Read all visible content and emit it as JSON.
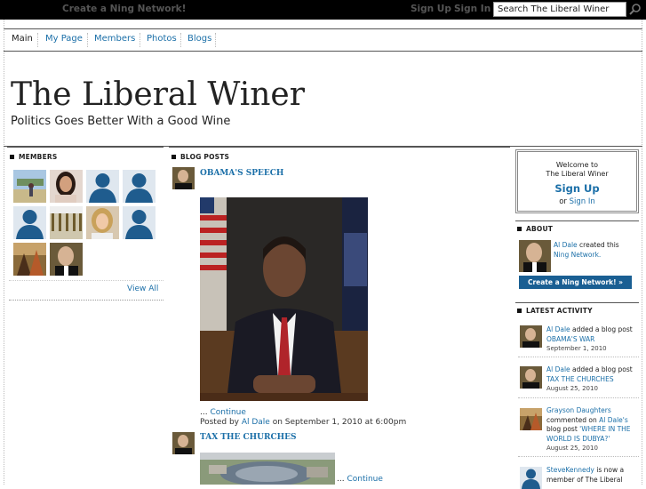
{
  "topbar": {
    "create_label": "Create a Ning Network!",
    "signup_label": "Sign Up",
    "signin_label": "Sign In",
    "search_value": "Search The Liberal Winer"
  },
  "nav": {
    "items": [
      "Main",
      "My Page",
      "Members",
      "Photos",
      "Blogs"
    ]
  },
  "header": {
    "title": "The Liberal Winer",
    "tagline": "Politics Goes Better With a Good Wine"
  },
  "members": {
    "heading": "MEMBERS",
    "view_all": "View All"
  },
  "blog": {
    "heading": "BLOG POSTS",
    "posts": [
      {
        "title": "OBAMA'S SPEECH",
        "continue_prefix": "... ",
        "continue_label": "Continue",
        "meta_prefix": "Posted by ",
        "author": "Al Dale",
        "meta_suffix": " on September 1, 2010 at 6:00pm"
      },
      {
        "title": "TAX THE CHURCHES",
        "continue_prefix": "... ",
        "continue_label": "Continue"
      }
    ]
  },
  "welcome": {
    "line1": "Welcome to",
    "line2": "The Liberal Winer",
    "signup": "Sign Up",
    "or": "or ",
    "signin": "Sign In"
  },
  "about": {
    "heading": "ABOUT",
    "author": "Al Dale",
    "created_text": " created this",
    "network_link": "Ning Network.",
    "button": "Create a Ning Network! »"
  },
  "activity": {
    "heading": "LATEST ACTIVITY",
    "items": [
      {
        "user": "Al Dale",
        "action": " added a blog post",
        "target": "OBAMA'S WAR",
        "date": "September 1, 2010"
      },
      {
        "user": "Al Dale",
        "action": " added a blog post",
        "target": "TAX THE CHURCHES",
        "date": "August 25, 2010"
      },
      {
        "user": "Grayson Daughters",
        "action": " commented on ",
        "owner": "Al Dale's",
        "action2": " blog post ",
        "target": "'WHERE IN THE WORLD IS DUBYA?'",
        "date": "August 25, 2010"
      },
      {
        "user": "SteveKennedy",
        "action": " is now a member of The Liberal"
      }
    ]
  },
  "colors": {
    "link": "#1b6fa8",
    "topbar": "#000000",
    "button": "#1a5f93"
  }
}
